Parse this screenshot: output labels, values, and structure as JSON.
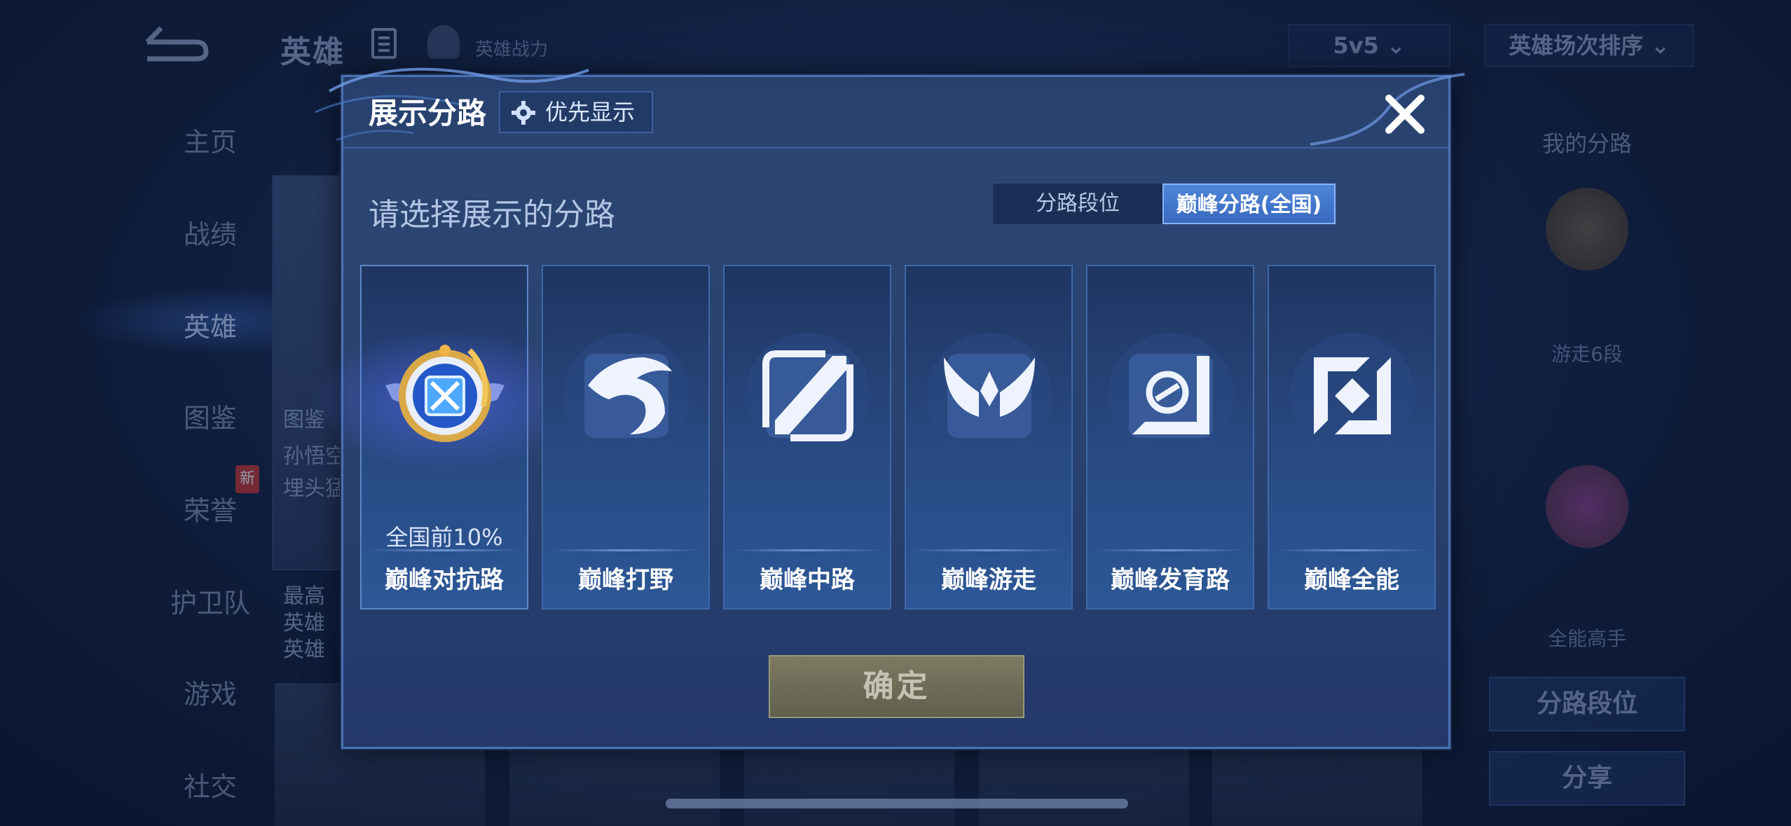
{
  "background": {
    "top_title": "英雄",
    "top_subtitle": "英雄战力",
    "mode_select": "5v5",
    "sort_select": "英雄场次排序",
    "sidebar": [
      {
        "label": "主页"
      },
      {
        "label": "战绩"
      },
      {
        "label": "英雄"
      },
      {
        "label": "图鉴"
      },
      {
        "label": "荣誉"
      },
      {
        "label": "护卫队"
      },
      {
        "label": "游戏"
      },
      {
        "label": "社交"
      }
    ],
    "new_badge": "新",
    "hero_card": {
      "tag": "图鉴",
      "name": "孙悟空",
      "desc": "埋头猛",
      "extra": [
        "最高",
        "英雄",
        "英雄"
      ]
    },
    "right_panel": {
      "title": "我的分路",
      "lane1_label": "游走6段",
      "lane2_label": "全能高手",
      "lane_rank_button": "分路段位",
      "share_button": "分享"
    }
  },
  "dialog": {
    "title": "展示分路",
    "priority_button": "优先显示",
    "prompt": "请选择展示的分路",
    "tabs": [
      {
        "label": "分路段位",
        "active": false
      },
      {
        "label": "巅峰分路(全国)",
        "active": true
      }
    ],
    "lanes": [
      {
        "name": "巅峰对抗路",
        "rank": "全国前10%",
        "selected": true,
        "icon": "swords-emblem-icon"
      },
      {
        "name": "巅峰打野",
        "rank": "",
        "selected": false,
        "icon": "dragon-icon"
      },
      {
        "name": "巅峰中路",
        "rank": "",
        "selected": false,
        "icon": "slash-icon"
      },
      {
        "name": "巅峰游走",
        "rank": "",
        "selected": false,
        "icon": "wings-icon"
      },
      {
        "name": "巅峰发育路",
        "rank": "",
        "selected": false,
        "icon": "target-icon"
      },
      {
        "name": "巅峰全能",
        "rank": "",
        "selected": false,
        "icon": "diamond-icon"
      }
    ],
    "confirm_button": "确定"
  },
  "colors": {
    "accent": "#3869be",
    "card_border": "#3f67a8",
    "confirm_disabled": "#6e6d57"
  }
}
